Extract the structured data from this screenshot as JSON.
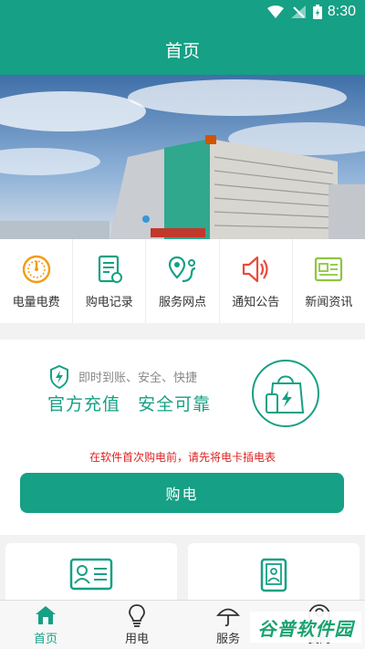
{
  "status": {
    "time": "8:30"
  },
  "app": {
    "title": "首页"
  },
  "quick_nav": [
    {
      "label": "电量电费",
      "icon": "gauge-icon",
      "color": "#f39c12"
    },
    {
      "label": "购电记录",
      "icon": "record-icon",
      "color": "#16a085"
    },
    {
      "label": "服务网点",
      "icon": "map-pin-icon",
      "color": "#16a085"
    },
    {
      "label": "通知公告",
      "icon": "speaker-icon",
      "color": "#e74c3c"
    },
    {
      "label": "新闻资讯",
      "icon": "news-icon",
      "color": "#8dc63f"
    }
  ],
  "promo": {
    "subtitle": "即时到账、安全、快捷",
    "title_a": "官方充值",
    "title_b": "安全可靠",
    "notice": "在软件首次购电前，请先将电卡插电表",
    "buy_label": "购电"
  },
  "tabs": [
    {
      "label": "首页",
      "icon": "home-icon",
      "active": true
    },
    {
      "label": "用电",
      "icon": "bulb-icon",
      "active": false
    },
    {
      "label": "服务",
      "icon": "umbrella-icon",
      "active": false
    },
    {
      "label": "我的",
      "icon": "user-icon",
      "active": false
    }
  ],
  "watermark": "谷普软件园",
  "colors": {
    "primary": "#16a085",
    "notice": "#e02020"
  }
}
